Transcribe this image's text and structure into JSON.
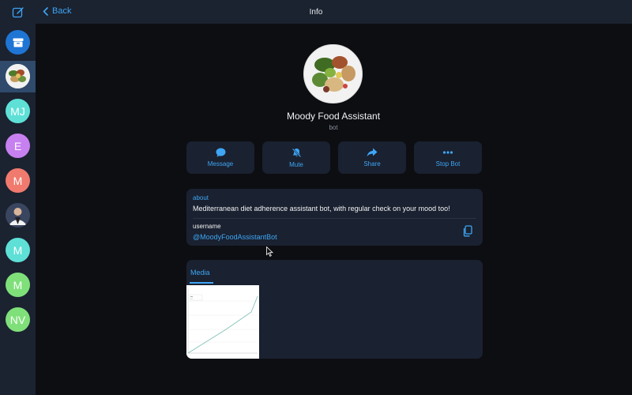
{
  "topbar": {
    "back_label": "Back",
    "title": "Info"
  },
  "sidebar": {
    "items": [
      {
        "initials": "",
        "color": "#1e75d4",
        "kind": "archive"
      },
      {
        "initials": "",
        "color": "#f1f1f1",
        "kind": "food-photo"
      },
      {
        "initials": "MJ",
        "color": "#5ee0d7"
      },
      {
        "initials": "E",
        "color": "#c780f0"
      },
      {
        "initials": "M",
        "color": "#f07a6e"
      },
      {
        "initials": "",
        "color": "#35405a",
        "kind": "person-photo"
      },
      {
        "initials": "M",
        "color": "#5ee0d7"
      },
      {
        "initials": "M",
        "color": "#7fe07a"
      },
      {
        "initials": "NV",
        "color": "#7fe07a"
      }
    ]
  },
  "profile": {
    "name": "Moody Food Assistant",
    "subtitle": "bot"
  },
  "actions": [
    {
      "label": "Message",
      "icon": "message-icon"
    },
    {
      "label": "Mute",
      "icon": "mute-icon"
    },
    {
      "label": "Share",
      "icon": "share-icon"
    },
    {
      "label": "Stop Bot",
      "icon": "more-icon"
    }
  ],
  "info": {
    "about_label": "about",
    "about_text": "Mediterranean diet adherence assistant bot, with regular check on your mood too!",
    "username_label": "username",
    "username_value": "@MoodyFoodAssistantBot"
  },
  "media": {
    "tab_label": "Media"
  },
  "colors": {
    "accent": "#3ea6f5",
    "background": "#0d0e12",
    "panel": "#1a2130",
    "sidebar": "#1b2230"
  }
}
